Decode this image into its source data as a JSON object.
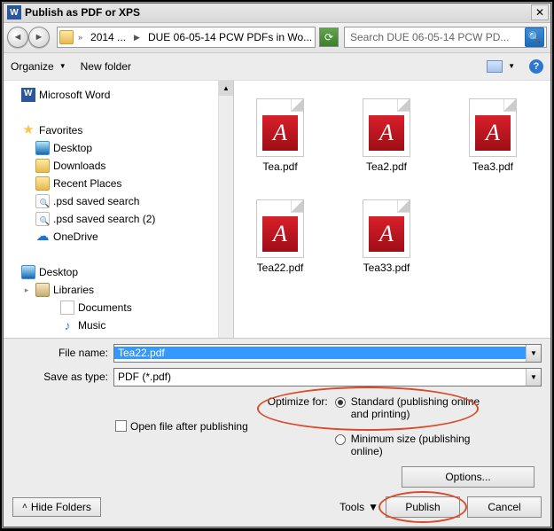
{
  "title": "Publish as PDF or XPS",
  "crumbs": {
    "seg1": "2014 ...",
    "seg2": "DUE 06-05-14 PCW PDFs in Wo..."
  },
  "search_placeholder": "Search DUE 06-05-14 PCW PD...",
  "toolbar": {
    "organize": "Organize",
    "newfolder": "New folder"
  },
  "tree": {
    "mw": "Microsoft Word",
    "fav": "Favorites",
    "desktop": "Desktop",
    "downloads": "Downloads",
    "recent": "Recent Places",
    "psd1": ".psd saved search",
    "psd2": ".psd saved search (2)",
    "onedrive": "OneDrive",
    "desk2": "Desktop",
    "libraries": "Libraries",
    "documents": "Documents",
    "music": "Music"
  },
  "files": {
    "f1": "Tea.pdf",
    "f2": "Tea2.pdf",
    "f3": "Tea3.pdf",
    "f4": "Tea22.pdf",
    "f5": "Tea33.pdf"
  },
  "labels": {
    "filename": "File name:",
    "saveastype": "Save as type:",
    "openafter": "Open file after publishing",
    "optimize": "Optimize for:",
    "standard": "Standard (publishing online and printing)",
    "minsize": "Minimum size (publishing online)",
    "options": "Options...",
    "hidefolders": "Hide Folders",
    "tools": "Tools",
    "publish": "Publish",
    "cancel": "Cancel"
  },
  "values": {
    "filename": "Tea22.pdf",
    "saveastype": "PDF (*.pdf)"
  }
}
